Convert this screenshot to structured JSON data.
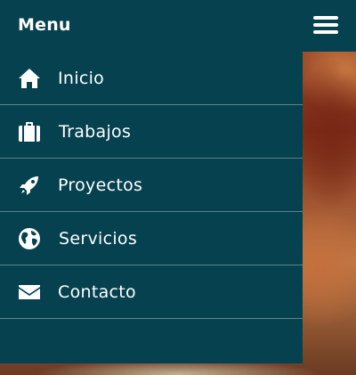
{
  "header": {
    "title": "Menu",
    "toggle_icon": "hamburger-menu-icon"
  },
  "nav": {
    "items": [
      {
        "label": "Inicio",
        "icon": "home-icon"
      },
      {
        "label": "Trabajos",
        "icon": "briefcase-icon"
      },
      {
        "label": "Proyectos",
        "icon": "rocket-icon"
      },
      {
        "label": "Servicios",
        "icon": "globe-icon"
      },
      {
        "label": "Contacto",
        "icon": "envelope-icon"
      }
    ]
  },
  "colors": {
    "drawer_background": "#05414f",
    "text": "#ffffff",
    "divider": "rgba(255,255,255,0.35)"
  }
}
